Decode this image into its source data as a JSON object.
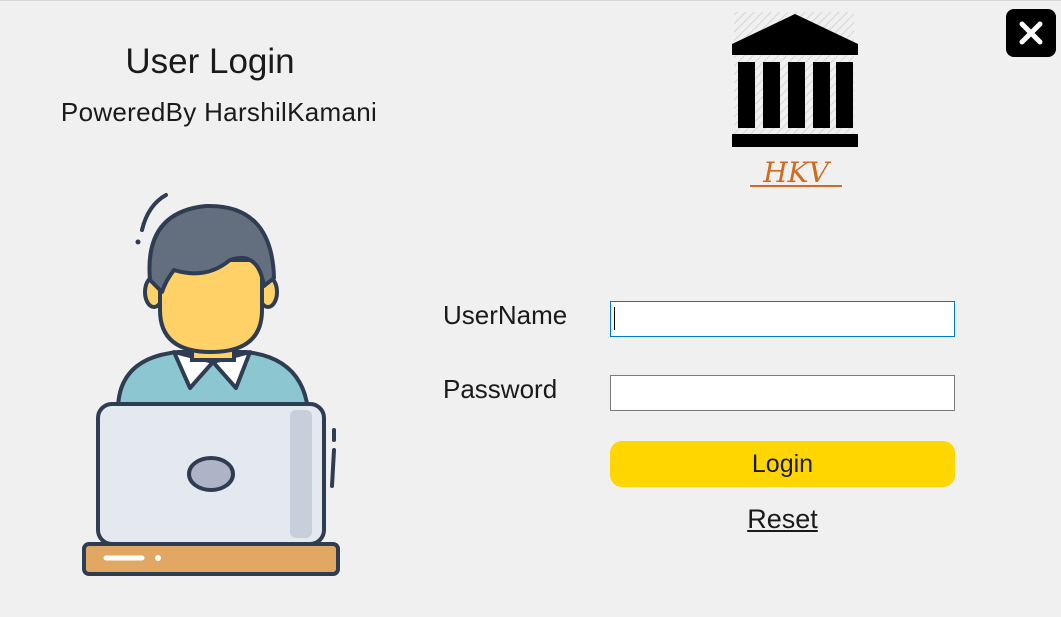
{
  "header": {
    "title": "User Login",
    "subtitle": "PoweredBy HarshilKamani"
  },
  "logo": {
    "icon": "bank-building-icon",
    "monogram": "HKV"
  },
  "form": {
    "username_label": "UserName",
    "username_value": "",
    "password_label": "Password",
    "password_value": "",
    "login_label": "Login",
    "reset_label": "Reset"
  },
  "icons": {
    "close": "close-icon",
    "avatar": "user-with-laptop-icon"
  },
  "colors": {
    "background": "#f0f0f0",
    "login_button": "#ffd600",
    "monogram": "#d2691e",
    "focus_border": "#0078d7",
    "avatar_hair": "#636e7f",
    "avatar_face": "#ffd166",
    "avatar_shirt": "#8cc7d1",
    "laptop_base": "#e0a863"
  }
}
